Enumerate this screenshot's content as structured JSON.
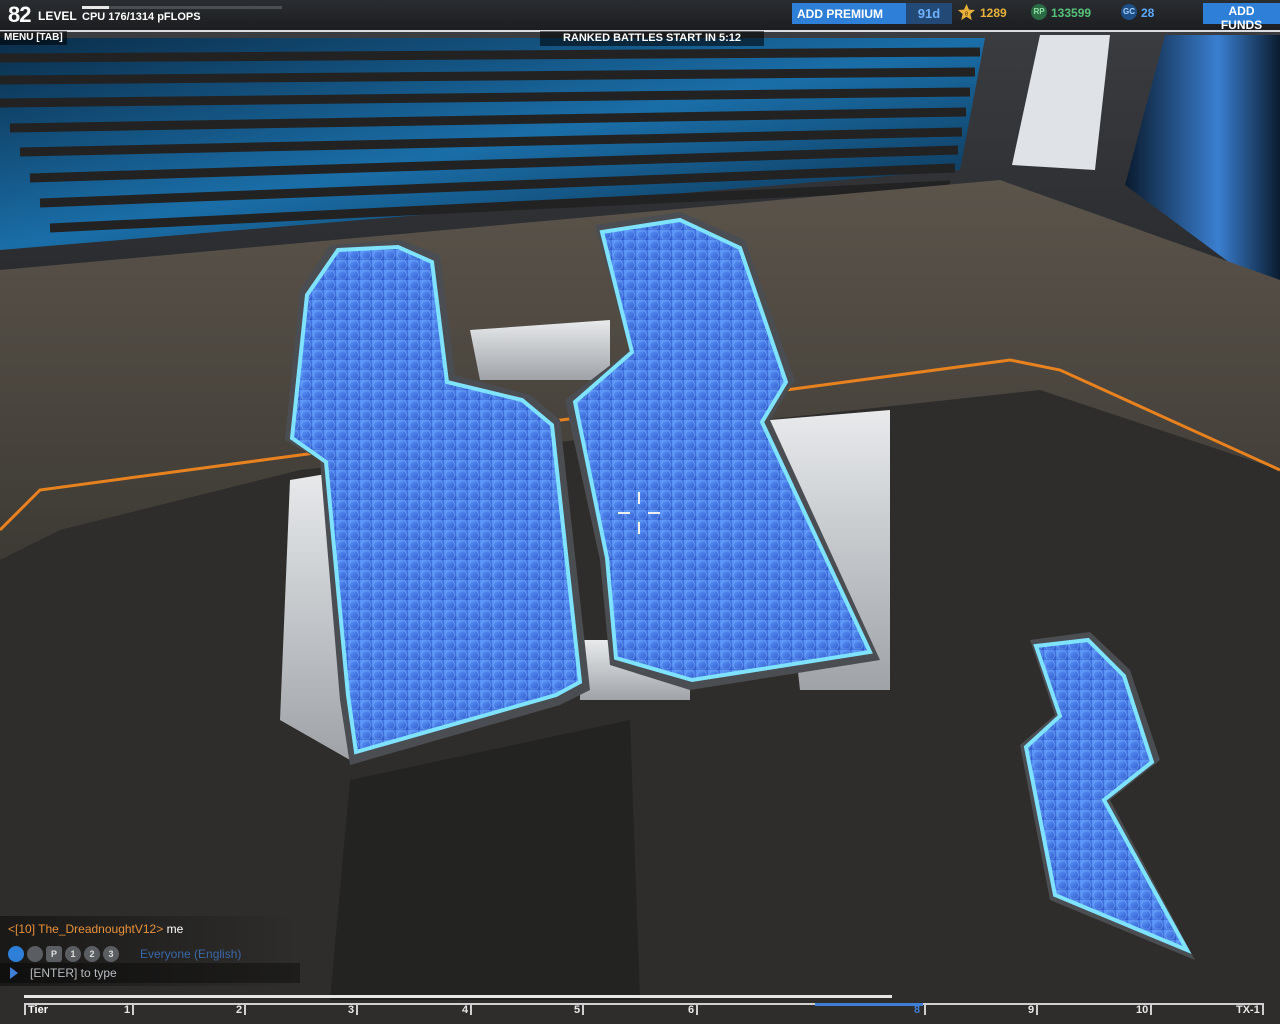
{
  "hud": {
    "level_number": "82",
    "level_label": "LEVEL",
    "cpu_text": "CPU 176/1314 pFLOPS",
    "cpu_fraction": 0.134,
    "menu_label": "MENU [TAB]",
    "ranked_banner": "RANKED BATTLES START IN 5:12",
    "premium_button": "ADD PREMIUM",
    "premium_days": "91d",
    "tier_points": "1289",
    "rp_icon_label": "RP",
    "rp_value": "133599",
    "gc_icon_label": "GC",
    "gc_value": "28",
    "funds_button": "ADD FUNDS"
  },
  "chat": {
    "sender": "<[10] The_DreadnoughtV12>",
    "message": "me",
    "channel_label": "Everyone (English)",
    "input_placeholder": "[ENTER] to type",
    "channels": [
      {
        "icon": "globe-icon",
        "label": ""
      },
      {
        "icon": "crosshair-person-icon",
        "label": ""
      },
      {
        "icon": "party-icon",
        "label": "P"
      },
      {
        "icon": "team1-icon",
        "label": "1"
      },
      {
        "icon": "team2-icon",
        "label": "2"
      },
      {
        "icon": "team3-icon",
        "label": "3"
      }
    ]
  },
  "tier_ruler": {
    "title": "Tier",
    "ticks": [
      "1",
      "2",
      "3",
      "4",
      "5",
      "6",
      "8",
      "9",
      "10",
      "TX-1"
    ],
    "current_tier": "8",
    "progress_fraction": 0.7
  },
  "colors": {
    "accent_blue": "#2e7fd8",
    "tier_gold": "#e8b23a",
    "rp_green": "#56c279",
    "gc_blue": "#5aa9ff",
    "chat_name_orange": "#e8913a"
  }
}
